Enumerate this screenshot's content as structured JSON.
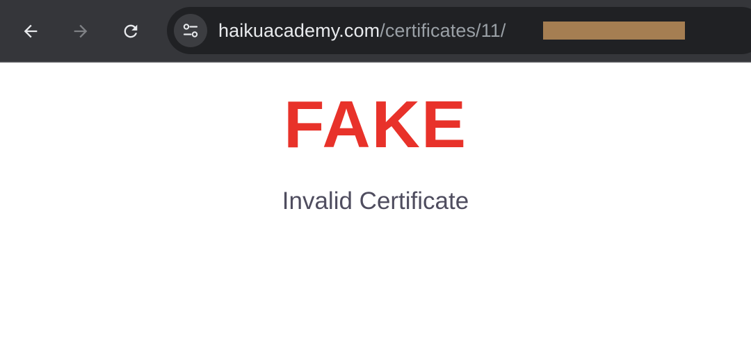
{
  "toolbar": {
    "back_icon": "arrow-left-icon",
    "forward_icon": "arrow-right-icon",
    "reload_icon": "reload-icon",
    "site_info_icon": "tune-icon",
    "url_host": "haikuacademy.com",
    "url_path": "/certificates/11/",
    "icon_color": "#e8eaed",
    "disabled_icon_color": "#7f8185",
    "redaction_color": "#a57e52"
  },
  "page": {
    "heading": "FAKE",
    "subtitle": "Invalid Certificate",
    "heading_color": "#e8322a",
    "subtitle_color": "#4f4d5f"
  }
}
